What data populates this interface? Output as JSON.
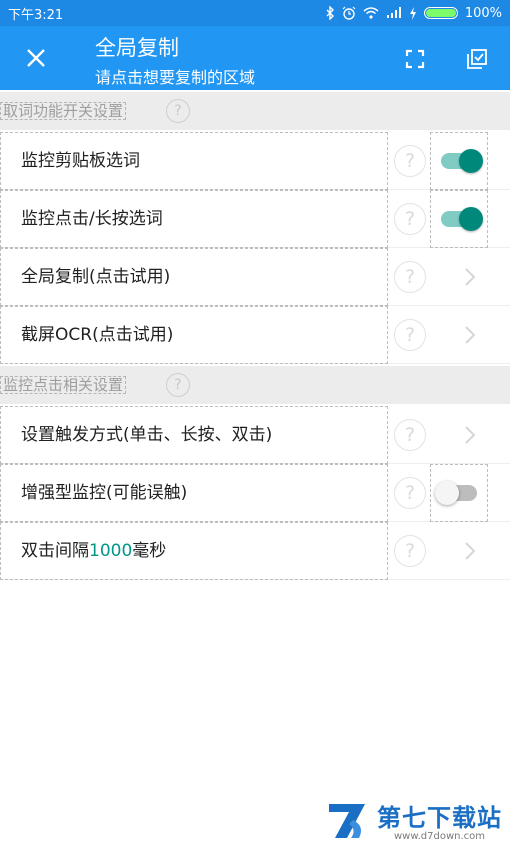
{
  "status_bar": {
    "time": "下午3:21",
    "battery": "100%"
  },
  "app_bar": {
    "title": "全局复制",
    "subtitle": "请点击想要复制的区域"
  },
  "sections": [
    {
      "header": "取词功能开关设置",
      "rows": [
        {
          "label": "监控剪贴板选词",
          "control": "toggle",
          "on": true
        },
        {
          "label": "监控点击/长按选词",
          "control": "toggle",
          "on": true
        },
        {
          "label": "全局复制(点击试用)",
          "control": "chevron"
        },
        {
          "label": "截屏OCR(点击试用)",
          "control": "chevron"
        }
      ]
    },
    {
      "header": "监控点击相关设置",
      "rows": [
        {
          "label": "设置触发方式(单击、长按、双击)",
          "control": "chevron"
        },
        {
          "label": "增强型监控(可能误触)",
          "control": "toggle",
          "on": false
        },
        {
          "label_prefix": "双击间隔",
          "label_value": "1000",
          "label_suffix": "毫秒",
          "control": "chevron"
        }
      ]
    }
  ],
  "watermark": {
    "name": "第七下载站",
    "url": "www.d7down.com"
  },
  "help_glyph": "?",
  "colors": {
    "status_bar": "#1e88e5",
    "app_bar": "#2196f3",
    "toggle_on": "#00897b",
    "accent_value": "#009688"
  }
}
